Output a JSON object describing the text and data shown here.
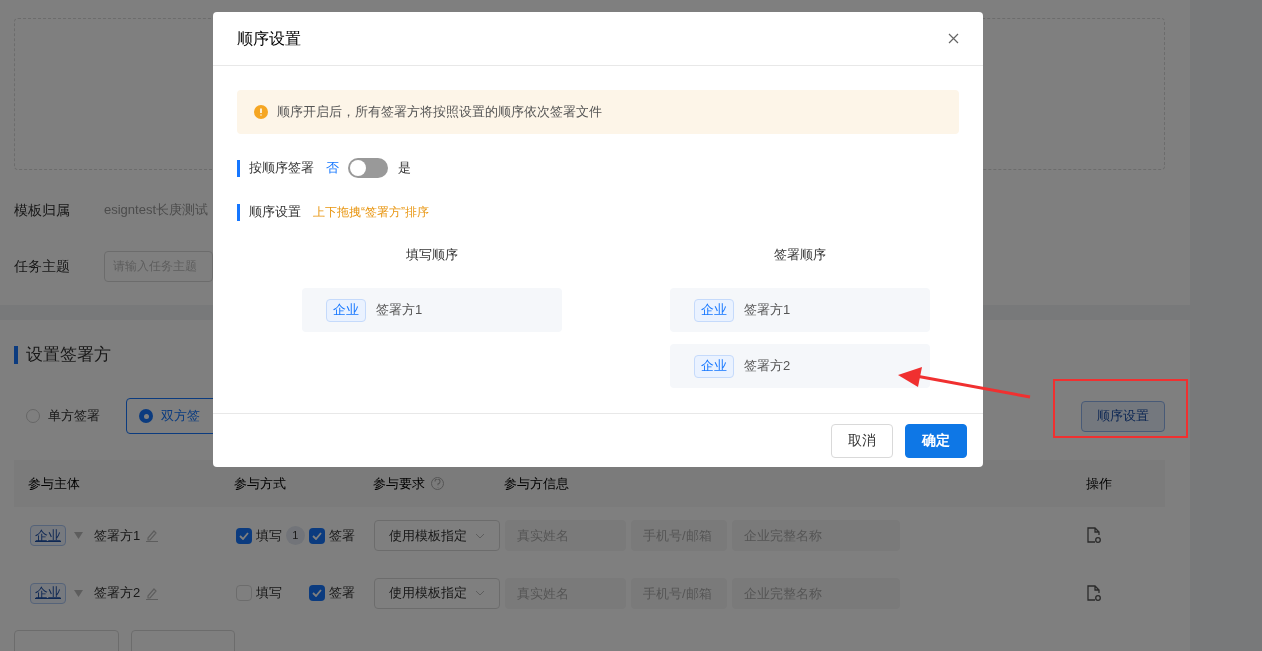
{
  "page": {
    "template_owner": {
      "label": "模板归属",
      "value": "esigntest长庚测试"
    },
    "task_subject": {
      "label": "任务主题",
      "placeholder": "请输入任务主题"
    },
    "signers_section": {
      "title": "设置签署方",
      "modes": [
        {
          "label": "单方签署",
          "selected": false
        },
        {
          "label": "双方签",
          "selected": true
        }
      ],
      "order_button": "顺序设置",
      "table": {
        "columns": [
          "参与主体",
          "参与方式",
          "参与要求",
          "参与方信息",
          "操作"
        ],
        "rows": [
          {
            "entity": "企业",
            "name": "签署方1",
            "fill": {
              "label": "填写",
              "checked": true,
              "badge": "1"
            },
            "sign": {
              "label": "签署",
              "checked": true
            },
            "requirement": "使用模板指定",
            "fields": [
              {
                "placeholder": "真实姓名"
              },
              {
                "placeholder": "手机号/邮箱"
              },
              {
                "placeholder": "企业完整名称"
              }
            ]
          },
          {
            "entity": "企业",
            "name": "签署方2",
            "fill": {
              "label": "填写",
              "checked": false
            },
            "sign": {
              "label": "签署",
              "checked": true
            },
            "requirement": "使用模板指定",
            "fields": [
              {
                "placeholder": "真实姓名"
              },
              {
                "placeholder": "手机号/邮箱"
              },
              {
                "placeholder": "企业完整名称"
              }
            ]
          }
        ]
      }
    }
  },
  "dialog": {
    "title": "顺序设置",
    "alert": "顺序开启后，所有签署方将按照设置的顺序依次签署文件",
    "sequential": {
      "label": "按顺序签署",
      "off_label": "否",
      "on_label": "是",
      "on": false
    },
    "order": {
      "label": "顺序设置",
      "hint": "上下拖拽“签署方”排序"
    },
    "columns": [
      {
        "title": "填写顺序",
        "items": [
          {
            "tag": "企业",
            "name": "签署方1"
          }
        ]
      },
      {
        "title": "签署顺序",
        "items": [
          {
            "tag": "企业",
            "name": "签署方1"
          },
          {
            "tag": "企业",
            "name": "签署方2"
          }
        ]
      }
    ],
    "buttons": [
      {
        "label": "取消",
        "kind": "secondary"
      },
      {
        "label": "确定",
        "kind": "primary"
      }
    ]
  }
}
